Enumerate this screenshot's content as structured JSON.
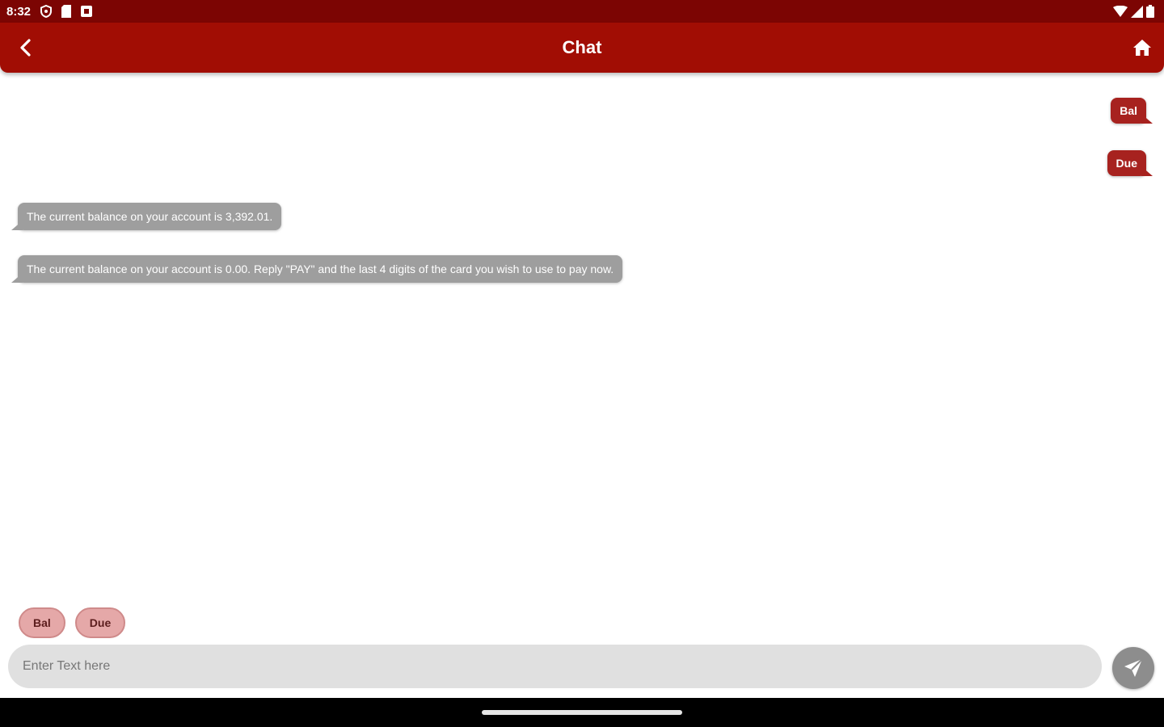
{
  "status_bar": {
    "time": "8:32",
    "left_icons": [
      "shield-icon",
      "sim-card-icon",
      "notification-square-icon"
    ],
    "right_icons": [
      "wifi-icon",
      "cell-signal-icon",
      "battery-icon"
    ]
  },
  "app_bar": {
    "title": "Chat",
    "background": "#a10d04"
  },
  "messages": [
    {
      "from": "user",
      "text": "Bal"
    },
    {
      "from": "user",
      "text": "Due"
    },
    {
      "from": "bot",
      "text": "The current balance on your account is 3,392.01."
    },
    {
      "from": "bot",
      "text": "The current balance on your account is 0.00. Reply \"PAY\" and the last 4 digits of the card you wish to use to pay now."
    }
  ],
  "quick_replies": [
    "Bal",
    "Due"
  ],
  "composer": {
    "placeholder": "Enter Text here",
    "value": ""
  },
  "colors": {
    "status_bar": "#7c0503",
    "user_bubble": "#a7221f",
    "bot_bubble": "#9e9e9e",
    "chip": "#e5a8a8"
  }
}
